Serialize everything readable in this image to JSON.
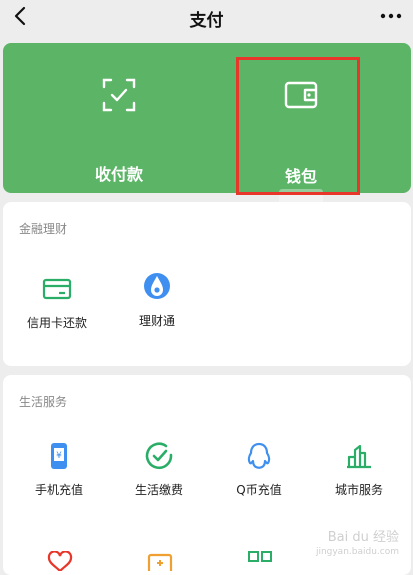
{
  "nav": {
    "title": "支付",
    "back_icon": "chevron-left-icon",
    "more_icon": "more-icon"
  },
  "pay": [
    {
      "label": "收付款",
      "icon": "scan-frame-icon"
    },
    {
      "label": "钱包",
      "icon": "wallet-icon"
    }
  ],
  "colors": {
    "accent": "#5cb467",
    "highlight": "#e8362a",
    "icon_green": "#2aae67",
    "icon_blue": "#3f8ff0"
  },
  "finance": {
    "title": "金融理财",
    "items": [
      {
        "label": "信用卡还款",
        "icon": "credit-card-icon"
      },
      {
        "label": "理财通",
        "icon": "drop-icon"
      }
    ]
  },
  "life": {
    "title": "生活服务",
    "items": [
      {
        "label": "手机充值",
        "icon": "phone-icon"
      },
      {
        "label": "生活缴费",
        "icon": "check-leaf-icon"
      },
      {
        "label": "Q币充值",
        "icon": "penguin-icon"
      },
      {
        "label": "城市服务",
        "icon": "city-icon"
      }
    ]
  },
  "watermark": {
    "brand": "Bai du 经验",
    "url": "jingyan.baidu.com"
  }
}
